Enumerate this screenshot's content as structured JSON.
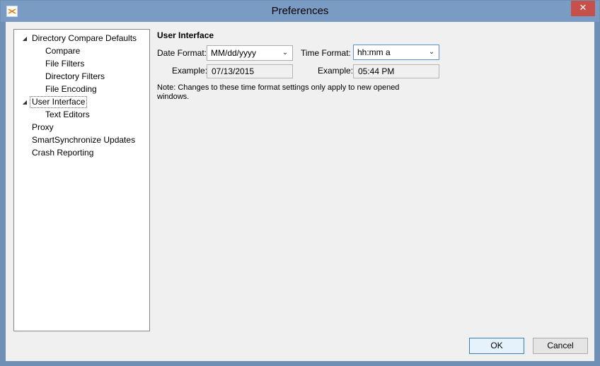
{
  "window": {
    "title": "Preferences",
    "close_glyph": "✕"
  },
  "tree": {
    "items": [
      {
        "label": "Directory Compare Defaults",
        "expanded": true
      },
      {
        "label": "Compare"
      },
      {
        "label": "File Filters"
      },
      {
        "label": "Directory Filters"
      },
      {
        "label": "File Encoding"
      },
      {
        "label": "User Interface",
        "expanded": true,
        "selected": true
      },
      {
        "label": "Text Editors"
      },
      {
        "label": "Proxy"
      },
      {
        "label": "SmartSynchronize Updates"
      },
      {
        "label": "Crash Reporting"
      }
    ],
    "expander_glyph": "◢"
  },
  "panel": {
    "title": "User Interface",
    "date_format_label": "Date Format:",
    "date_format_value": "MM/dd/yyyy",
    "time_format_label": "Time Format:",
    "time_format_value": "hh:mm a",
    "example_label": "Example:",
    "date_example": "07/13/2015",
    "time_example": "05:44 PM",
    "note": "Note: Changes to these time format settings only apply to new opened windows.",
    "dropdown_glyph": "⌄"
  },
  "buttons": {
    "ok": "OK",
    "cancel": "Cancel"
  }
}
